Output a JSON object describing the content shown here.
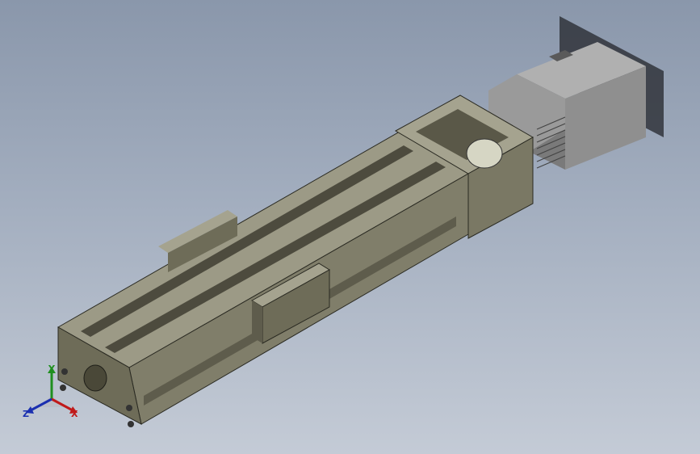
{
  "viewport": {
    "background_top": "#8a97ab",
    "background_bottom": "#c4cbd6",
    "model": "linear-actuator-assembly",
    "body_color": "#6e6c58",
    "motor_color": "#8f8f8f"
  },
  "triad": {
    "x_label": "X",
    "y_label": "Y",
    "z_label": "Z",
    "x_color": "#c01a1a",
    "y_color": "#1f8f1f",
    "z_color": "#1a2fb0"
  }
}
